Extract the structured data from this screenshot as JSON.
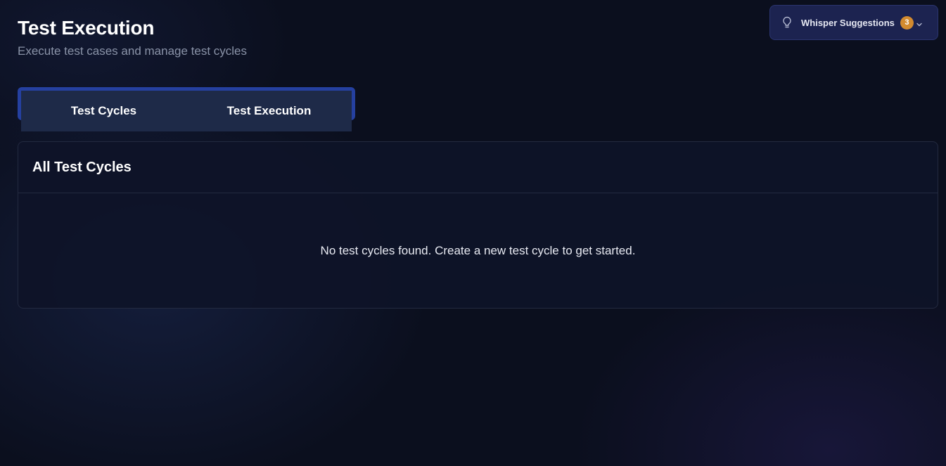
{
  "header": {
    "title": "Test Execution",
    "subtitle": "Execute test cases and manage test cycles"
  },
  "whisper": {
    "label": "Whisper Suggestions",
    "count": "3",
    "icon": "lightbulb-icon",
    "badge_color": "#d38b2f"
  },
  "tabs": [
    {
      "label": "Test Cycles"
    },
    {
      "label": "Test Execution"
    }
  ],
  "card": {
    "title": "All Test Cycles",
    "empty_message": "No test cycles found. Create a new test cycle to get started."
  },
  "colors": {
    "background": "#0b0f1e",
    "accent": "#2540a0",
    "tab_bg": "#1e2a48"
  }
}
